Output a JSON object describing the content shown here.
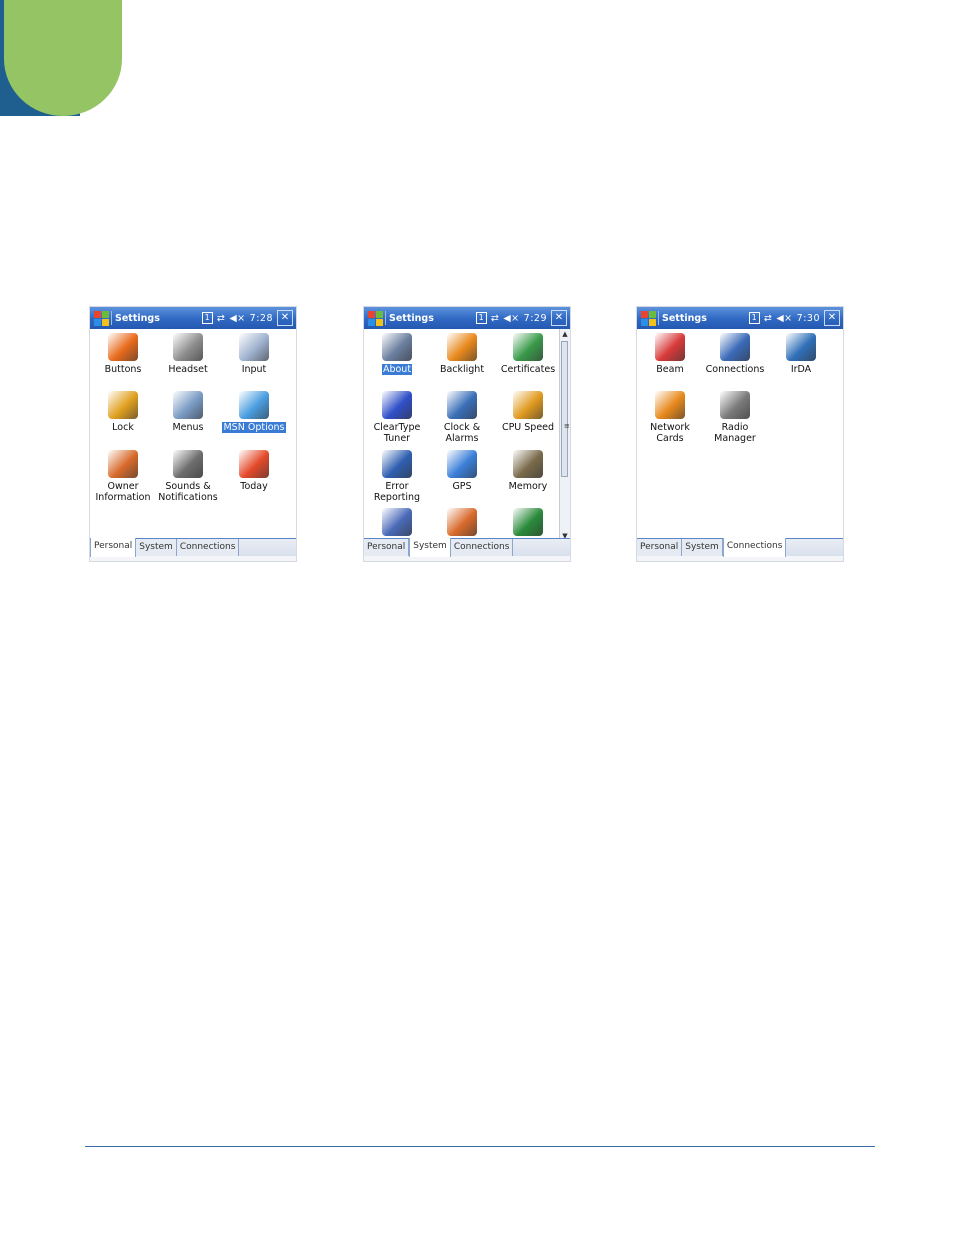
{
  "screens": [
    {
      "title": "Settings",
      "time": "7:28",
      "status_badge": "1",
      "close_glyph": "✕",
      "items": [
        {
          "label": "Buttons",
          "icon": "buttons-icon",
          "color": "#e86a1c"
        },
        {
          "label": "Headset",
          "icon": "headset-icon",
          "color": "#8f8f8f"
        },
        {
          "label": "Input",
          "icon": "keyboard-icon",
          "color": "#9fb2cf"
        },
        {
          "label": "Lock",
          "icon": "key-lock-icon",
          "color": "#e0a020"
        },
        {
          "label": "Menus",
          "icon": "menus-icon",
          "color": "#7a9bc4"
        },
        {
          "label": "MSN Options",
          "icon": "msn-butterfly-icon",
          "color": "#4a9de0",
          "selected": true
        },
        {
          "label": "Owner Information",
          "icon": "owner-icon",
          "color": "#d86a2c"
        },
        {
          "label": "Sounds & Notifications",
          "icon": "speaker-icon",
          "color": "#6d6d6d"
        },
        {
          "label": "Today",
          "icon": "today-icon",
          "color": "#e44a2a"
        }
      ],
      "tabs": [
        "Personal",
        "System",
        "Connections"
      ],
      "active_tab": 0
    },
    {
      "title": "Settings",
      "time": "7:29",
      "status_badge": "1",
      "close_glyph": "✕",
      "items": [
        {
          "label": "About",
          "icon": "about-device-icon",
          "color": "#6a7e9e",
          "selected": true
        },
        {
          "label": "Backlight",
          "icon": "backlight-icon",
          "color": "#e8891c"
        },
        {
          "label": "Certificates",
          "icon": "certificate-icon",
          "color": "#3a9a4a"
        },
        {
          "label": "ClearType Tuner",
          "icon": "cleartype-icon",
          "color": "#3050c8"
        },
        {
          "label": "Clock & Alarms",
          "icon": "clock-icon",
          "color": "#3a6fb8"
        },
        {
          "label": "CPU Speed",
          "icon": "cpu-speed-icon",
          "color": "#e09a20"
        },
        {
          "label": "Error Reporting",
          "icon": "error-report-icon",
          "color": "#2f5fb0"
        },
        {
          "label": "GPS",
          "icon": "gps-globe-icon",
          "color": "#3a7ed8"
        },
        {
          "label": "Memory",
          "icon": "memory-chip-icon",
          "color": "#7a6a4a"
        },
        {
          "label": "",
          "icon": "checkered-icon",
          "color": "#4a6ab8"
        },
        {
          "label": "",
          "icon": "power-icon",
          "color": "#d86a2c"
        },
        {
          "label": "",
          "icon": "regional-globe-icon",
          "color": "#2a8a3a"
        }
      ],
      "tabs": [
        "Personal",
        "System",
        "Connections"
      ],
      "active_tab": 1
    },
    {
      "title": "Settings",
      "time": "7:30",
      "status_badge": "1",
      "close_glyph": "✕",
      "items": [
        {
          "label": "Beam",
          "icon": "beam-icon",
          "color": "#d83a3a"
        },
        {
          "label": "Connections",
          "icon": "connections-icon",
          "color": "#3a6ab8"
        },
        {
          "label": "IrDA",
          "icon": "irda-icon",
          "color": "#2f6fb8"
        },
        {
          "label": "Network Cards",
          "icon": "network-card-icon",
          "color": "#e8891c"
        },
        {
          "label": "Radio Manager",
          "icon": "radio-manager-icon",
          "color": "#7a7a7a"
        }
      ],
      "tabs": [
        "Personal",
        "System",
        "Connections"
      ],
      "active_tab": 2
    }
  ]
}
